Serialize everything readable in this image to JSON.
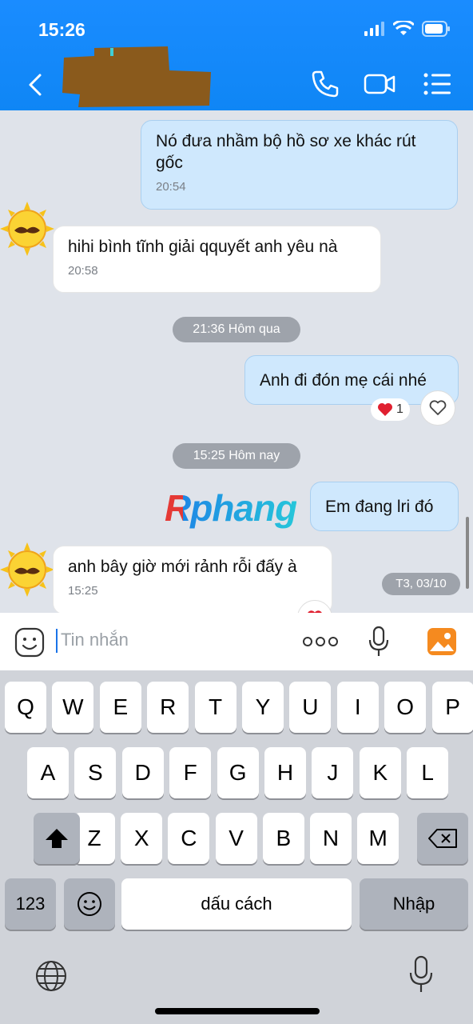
{
  "status_bar": {
    "time": "15:26"
  },
  "header": {
    "contact_name": ""
  },
  "messages": [
    {
      "id": "m1",
      "sender": "me",
      "text": "Nó đưa nhầm bộ hồ sơ xe khác rút gốc",
      "time": "20:54"
    },
    {
      "id": "m2",
      "sender": "them",
      "text": "hihi bình tĩnh giải qquyết anh yêu nà",
      "time": "20:58"
    },
    {
      "id": "sep1",
      "type": "separator",
      "text": "21:36 Hôm qua"
    },
    {
      "id": "m3",
      "sender": "me",
      "text": "Anh đi đón mẹ cái nhé",
      "reaction_count": "1"
    },
    {
      "id": "sep2",
      "type": "separator",
      "text": "15:25 Hôm nay"
    },
    {
      "id": "m4",
      "sender": "me",
      "text": "Em đang lri đó"
    },
    {
      "id": "m5",
      "sender": "them",
      "text": "anh bây giờ mới rảnh rỗi đấy à",
      "time": "15:25"
    }
  ],
  "watermark": "Rphang",
  "date_badge": "T3, 03/10",
  "input": {
    "placeholder": "Tin nhắn"
  },
  "keyboard": {
    "row1": [
      "Q",
      "W",
      "E",
      "R",
      "T",
      "Y",
      "U",
      "I",
      "O",
      "P"
    ],
    "row2": [
      "A",
      "S",
      "D",
      "F",
      "G",
      "H",
      "J",
      "K",
      "L"
    ],
    "row3": [
      "Z",
      "X",
      "C",
      "V",
      "B",
      "N",
      "M"
    ],
    "numbers_key": "123",
    "space_label": "dấu cách",
    "return_label": "Nhập"
  },
  "colors": {
    "header_blue": "#0f86f5",
    "me_bubble": "#cfe8fd",
    "chat_bg": "#dfe3ea"
  }
}
